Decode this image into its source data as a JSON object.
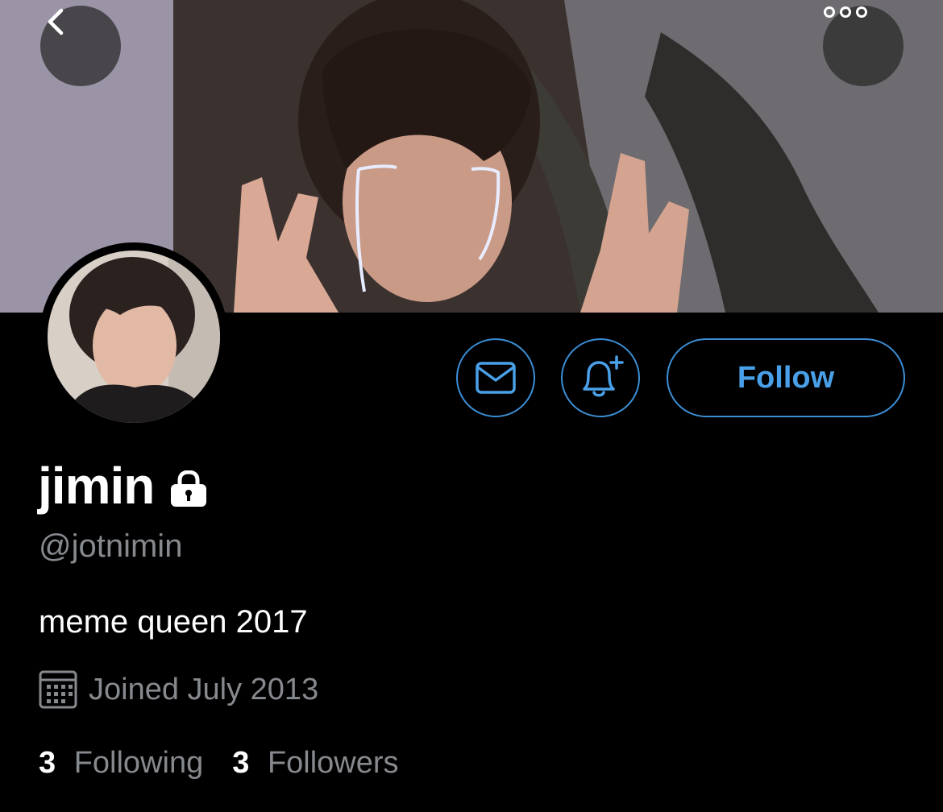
{
  "header": {
    "back_icon": "chevron-left-icon",
    "more_icon": "more-horizontal-icon"
  },
  "profile": {
    "display_name": "jimin",
    "protected_icon": "lock-icon",
    "handle": "@jotnimin",
    "bio": "meme queen 2017",
    "joined": "Joined July 2013",
    "joined_icon": "calendar-icon",
    "following_count": "3",
    "following_label": "Following",
    "followers_count": "3",
    "followers_label": "Followers"
  },
  "actions": {
    "message_icon": "mail-icon",
    "notify_icon": "bell-plus-icon",
    "follow_label": "Follow"
  },
  "colors": {
    "accent": "#3b8fd6",
    "background": "#000000",
    "secondary_text": "#86898d"
  }
}
